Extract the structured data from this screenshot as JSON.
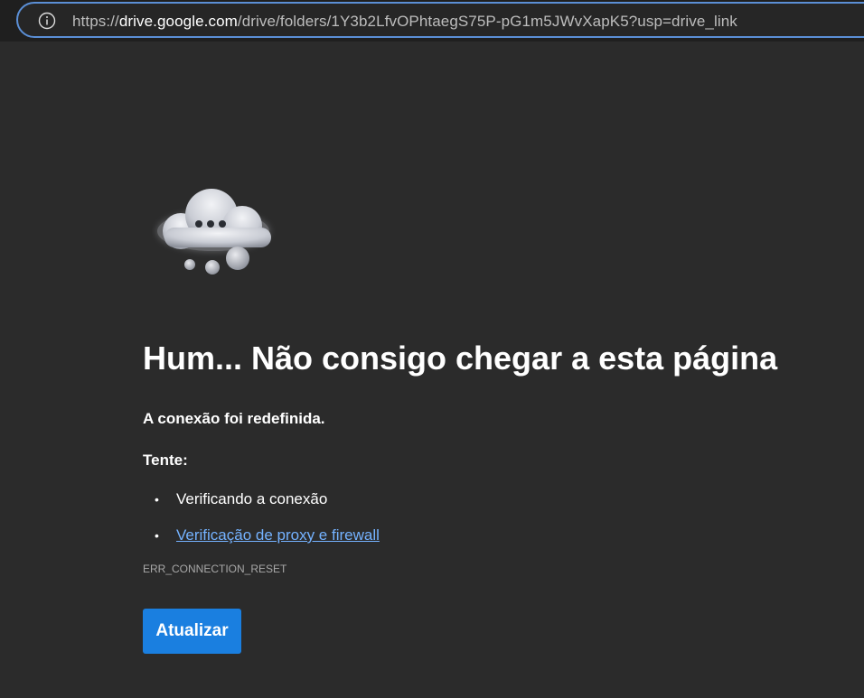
{
  "browser": {
    "url_scheme": "https://",
    "url_host": "drive.google.com",
    "url_path": "/drive/folders/1Y3b2LfvOPhtaegS75P-pG1m5JWvXapK5?usp=drive_link",
    "info_icon": "info-circle-icon"
  },
  "error_page": {
    "illustration_icon": "cloud-with-dots-icon",
    "title": "Hum... Não consigo chegar a esta página",
    "subtitle": "A conexão foi redefinida.",
    "try_label": "Tente:",
    "suggestions": [
      {
        "label": "Verificando a conexão",
        "is_link": false
      },
      {
        "label": "Verificação de proxy e firewall",
        "is_link": true
      }
    ],
    "error_code": "ERR_CONNECTION_RESET",
    "refresh_button_label": "Atualizar"
  },
  "colors": {
    "page_background": "#2b2b2b",
    "address_bar_border": "#5b8fd6",
    "link": "#74b2ff",
    "button": "#1a7fe0"
  }
}
